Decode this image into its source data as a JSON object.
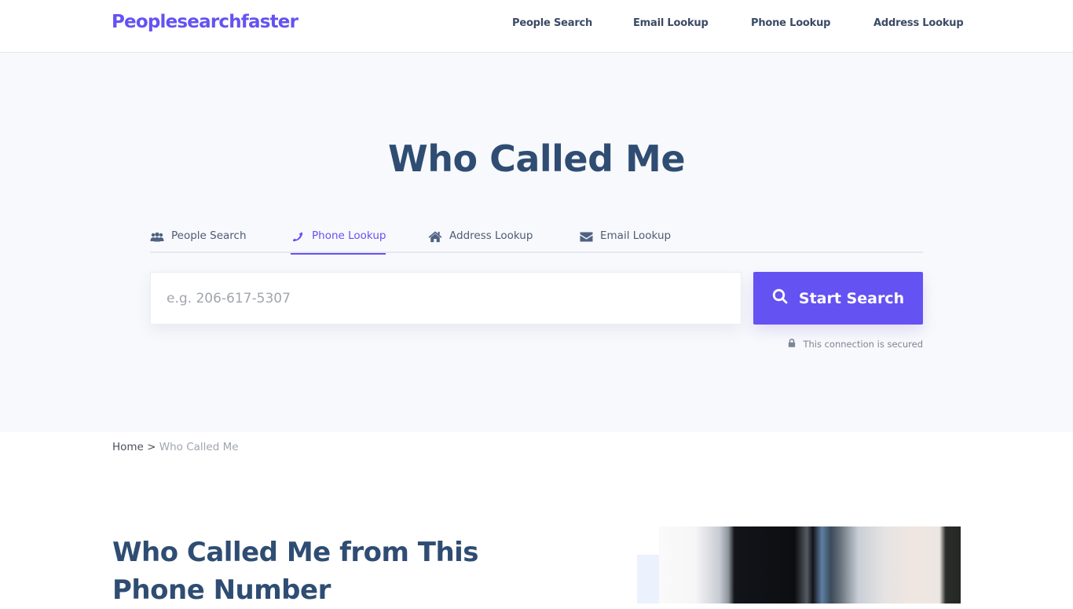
{
  "header": {
    "logo": "Peoplesearchfaster",
    "nav": [
      {
        "label": "People Search"
      },
      {
        "label": "Email Lookup"
      },
      {
        "label": "Phone Lookup"
      },
      {
        "label": "Address Lookup"
      }
    ]
  },
  "hero": {
    "title": "Who Called Me",
    "tabs": [
      {
        "label": "People Search",
        "icon": "users-icon",
        "active": false
      },
      {
        "label": "Phone Lookup",
        "icon": "phone-icon",
        "active": true
      },
      {
        "label": "Address Lookup",
        "icon": "home-icon",
        "active": false
      },
      {
        "label": "Email Lookup",
        "icon": "envelope-icon",
        "active": false
      }
    ],
    "search": {
      "value": "",
      "placeholder": "e.g. 206-617-5307",
      "button_label": "Start Search",
      "button_icon": "search-icon"
    },
    "secure_note": "This connection is secured",
    "secure_icon": "lock-icon"
  },
  "breadcrumb": {
    "home": "Home",
    "separator": ">",
    "current": "Who Called Me"
  },
  "content": {
    "section_title": "Who Called Me from This Phone Number"
  },
  "colors": {
    "brand": "#6552f2",
    "heading": "#2f4d73",
    "nav_text": "#3b4a66",
    "hero_bg": "#f8f9fc"
  }
}
